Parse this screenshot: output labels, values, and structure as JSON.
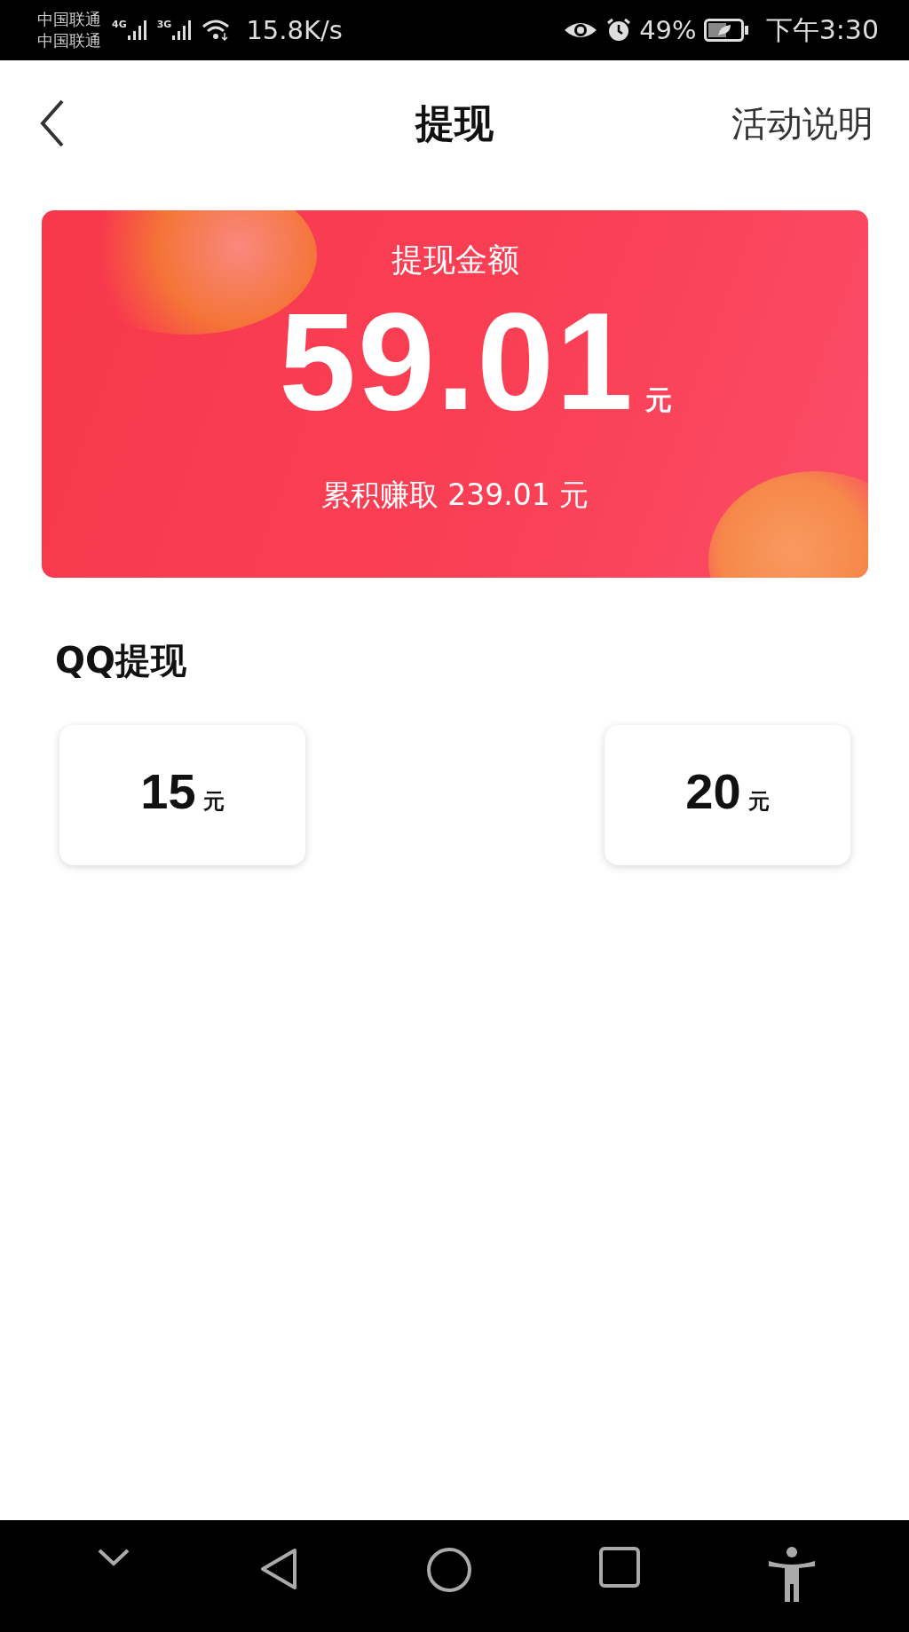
{
  "status_bar": {
    "carriers": [
      "中国联通",
      "中国联通"
    ],
    "signals": [
      {
        "network": "4G"
      },
      {
        "network": "3G"
      }
    ],
    "speed": "15.8K/s",
    "battery": "49%",
    "time": "下午3:30"
  },
  "header": {
    "title": "提现",
    "action": "活动说明"
  },
  "balance": {
    "label": "提现金额",
    "amount": "59.01",
    "unit": "元",
    "total_earned": "累积赚取 239.01 元"
  },
  "withdraw": {
    "title": "QQ提现",
    "options": [
      {
        "amount": "15",
        "unit": "元"
      },
      {
        "amount": "20",
        "unit": "元"
      }
    ]
  }
}
